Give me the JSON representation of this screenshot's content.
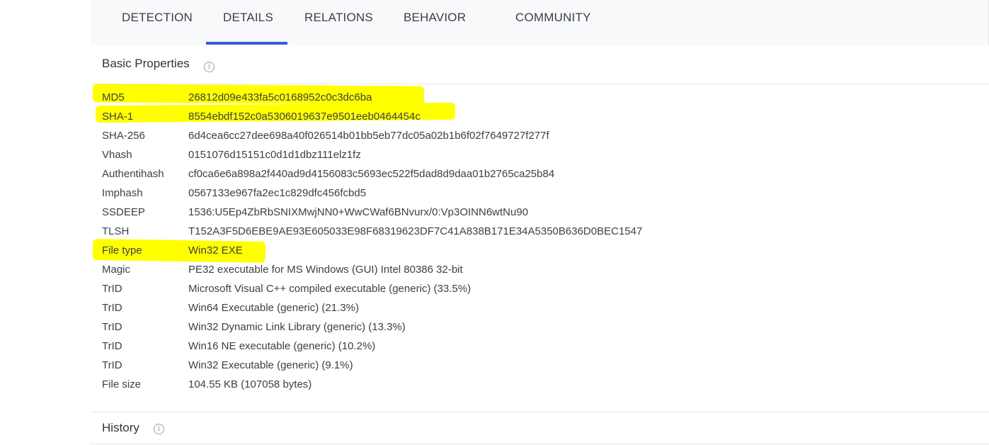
{
  "tabs": [
    {
      "label": "DETECTION"
    },
    {
      "label": "DETAILS"
    },
    {
      "label": "RELATIONS"
    },
    {
      "label": "BEHAVIOR"
    },
    {
      "label": "COMMUNITY"
    }
  ],
  "active_tab": "DETAILS",
  "basic_properties": {
    "title": "Basic Properties",
    "rows": [
      {
        "key": "MD5",
        "value": "26812d09e433fa5c0168952c0c3dc6ba"
      },
      {
        "key": "SHA-1",
        "value": "8554ebdf152c0a5306019637e9501eeb0464454c"
      },
      {
        "key": "SHA-256",
        "value": "6d4cea6cc27dee698a40f026514b01bb5eb77dc05a02b1b6f02f7649727f277f"
      },
      {
        "key": "Vhash",
        "value": "0151076d15151c0d1d1dbz111elz1fz"
      },
      {
        "key": "Authentihash",
        "value": "cf0ca6e6a898a2f440ad9d4156083c5693ec522f5dad8d9daa01b2765ca25b84"
      },
      {
        "key": "Imphash",
        "value": "0567133e967fa2ec1c829dfc456fcbd5"
      },
      {
        "key": "SSDEEP",
        "value": "1536:U5Ep4ZbRbSNIXMwjNN0+WwCWaf6BNvurx/0:Vp3OINN6wtNu90"
      },
      {
        "key": "TLSH",
        "value": "T152A3F5D6EBE9AE93E605033E98F68319623DF7C41A838B171E34A5350B636D0BEC1547"
      },
      {
        "key": "File type",
        "value": "Win32 EXE"
      },
      {
        "key": "Magic",
        "value": "PE32 executable for MS Windows (GUI) Intel 80386 32-bit"
      },
      {
        "key": "TrID",
        "value": "Microsoft Visual C++ compiled executable (generic) (33.5%)"
      },
      {
        "key": "TrID",
        "value": "Win64 Executable (generic) (21.3%)"
      },
      {
        "key": "TrID",
        "value": "Win32 Dynamic Link Library (generic) (13.3%)"
      },
      {
        "key": "TrID",
        "value": "Win16 NE executable (generic) (10.2%)"
      },
      {
        "key": "TrID",
        "value": "Win32 Executable (generic) (9.1%)"
      },
      {
        "key": "File size",
        "value": "104.55 KB (107058 bytes)"
      }
    ]
  },
  "history": {
    "title": "History"
  },
  "icons": {
    "info": "info-icon",
    "info_glyph": "i"
  },
  "colors": {
    "highlight": "#ffff00",
    "tab_underline": "#3a5bd9"
  }
}
